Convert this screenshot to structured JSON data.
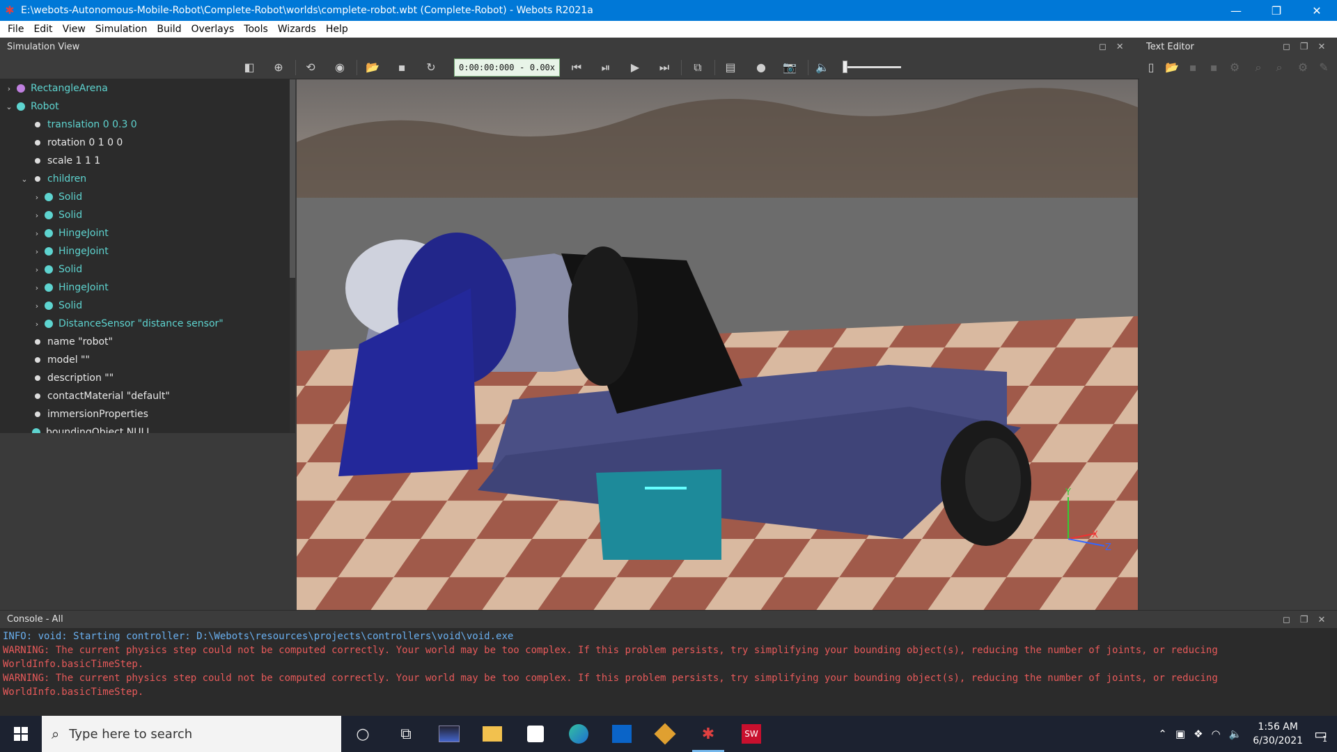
{
  "window": {
    "title": "E:\\webots-Autonomous-Mobile-Robot\\Complete-Robot\\worlds\\complete-robot.wbt (Complete-Robot) - Webots R2021a",
    "minimize": "—",
    "maximize": "❐",
    "close": "✕"
  },
  "menu": [
    "File",
    "Edit",
    "View",
    "Simulation",
    "Build",
    "Overlays",
    "Tools",
    "Wizards",
    "Help"
  ],
  "simulation_view": {
    "title": "Simulation View",
    "time": "0:00:00:000",
    "separator": "-",
    "speed": "0.00x"
  },
  "text_editor": {
    "title": "Text Editor"
  },
  "scene_tree": [
    {
      "label": "RectangleArena",
      "kind": "node",
      "dot": "#c080e0",
      "chevron": "›",
      "depth": 0
    },
    {
      "label": "Robot",
      "kind": "node",
      "dot": "#5ed4d0",
      "chevron": "⌄",
      "depth": 0
    },
    {
      "label": "translation 0 0.3 0",
      "kind": "fieldlink",
      "depth": 1
    },
    {
      "label": "rotation 0 1 0 0",
      "kind": "field",
      "depth": 1
    },
    {
      "label": "scale 1 1 1",
      "kind": "field",
      "depth": 1
    },
    {
      "label": "children",
      "kind": "fieldlink",
      "chevron": "⌄",
      "depth": 1
    },
    {
      "label": "Solid",
      "kind": "node",
      "dot": "#5ed4d0",
      "chevron": "›",
      "depth": 2
    },
    {
      "label": "Solid",
      "kind": "node",
      "dot": "#5ed4d0",
      "chevron": "›",
      "depth": 2
    },
    {
      "label": "HingeJoint",
      "kind": "node",
      "dot": "#5ed4d0",
      "chevron": "›",
      "depth": 2
    },
    {
      "label": "HingeJoint",
      "kind": "node",
      "dot": "#5ed4d0",
      "chevron": "›",
      "depth": 2
    },
    {
      "label": "Solid",
      "kind": "node",
      "dot": "#5ed4d0",
      "chevron": "›",
      "depth": 2
    },
    {
      "label": "HingeJoint",
      "kind": "node",
      "dot": "#5ed4d0",
      "chevron": "›",
      "depth": 2
    },
    {
      "label": "Solid",
      "kind": "node",
      "dot": "#5ed4d0",
      "chevron": "›",
      "depth": 2
    },
    {
      "label": "DistanceSensor \"distance sensor\"",
      "kind": "node",
      "dot": "#5ed4d0",
      "chevron": "›",
      "depth": 2
    },
    {
      "label": "name \"robot\"",
      "kind": "field",
      "depth": 1
    },
    {
      "label": "model \"\"",
      "kind": "field",
      "depth": 1
    },
    {
      "label": "description \"\"",
      "kind": "field",
      "depth": 1
    },
    {
      "label": "contactMaterial \"default\"",
      "kind": "field",
      "depth": 1
    },
    {
      "label": "immersionProperties",
      "kind": "field",
      "depth": 1
    },
    {
      "label": "boundingObject NULL",
      "kind": "field",
      "dot": "#5ed4d0",
      "depth": 1
    }
  ],
  "viewport": {
    "axis_x": "X",
    "axis_y": "Y",
    "axis_z": "Z"
  },
  "console": {
    "title": "Console - All",
    "lines": [
      {
        "type": "info",
        "text": "INFO: void: Starting controller: D:\\Webots\\resources\\projects\\controllers\\void\\void.exe"
      },
      {
        "type": "warn",
        "text": "WARNING: The current physics step could not be computed correctly. Your world may be too complex. If this problem persists, try simplifying your bounding object(s), reducing the number of joints, or reducing"
      },
      {
        "type": "warn",
        "text": "WorldInfo.basicTimeStep."
      },
      {
        "type": "warn",
        "text": "WARNING: The current physics step could not be computed correctly. Your world may be too complex. If this problem persists, try simplifying your bounding object(s), reducing the number of joints, or reducing"
      },
      {
        "type": "warn",
        "text": "WorldInfo.basicTimeStep."
      }
    ]
  },
  "taskbar": {
    "search_placeholder": "Type here to search",
    "time": "1:56 AM",
    "date": "6/30/2021",
    "notification_count": "1"
  },
  "colors": {
    "titlebar": "#0078d7",
    "node_text": "#5ed4d0",
    "warning": "#e85a5a",
    "info": "#6ab0f0"
  }
}
